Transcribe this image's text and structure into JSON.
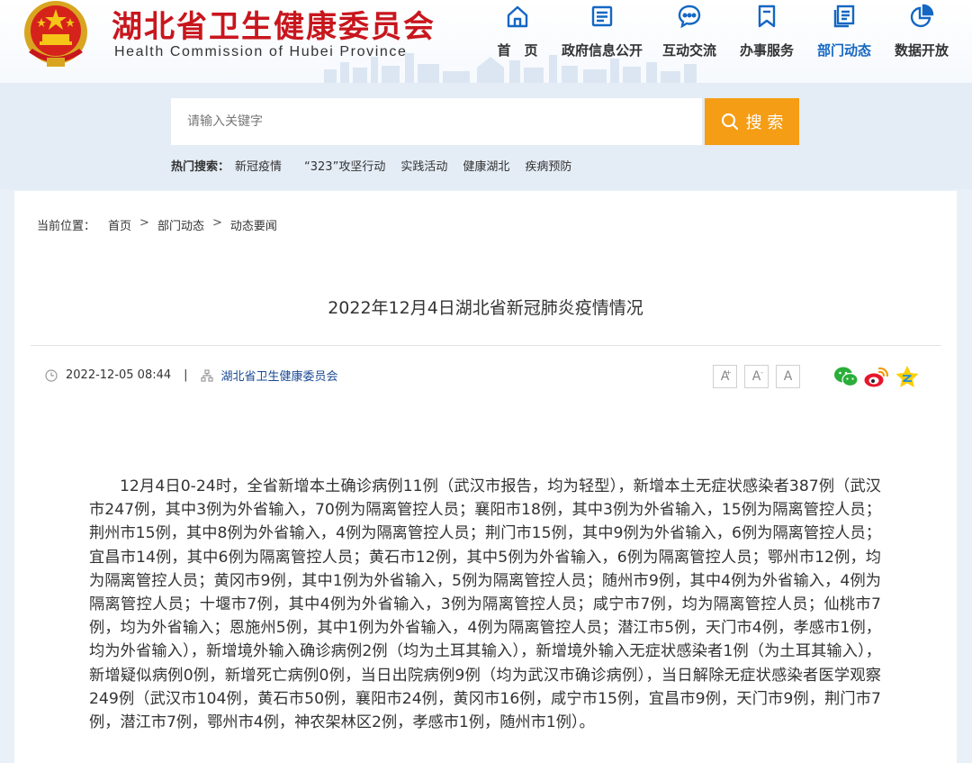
{
  "header": {
    "title": "湖北省卫生健康委员会",
    "subtitle": "Health Commission of Hubei Province"
  },
  "nav": {
    "items": [
      {
        "label": "首　页",
        "icon": "home-icon"
      },
      {
        "label": "政府信息公开",
        "icon": "document-list-icon"
      },
      {
        "label": "互动交流",
        "icon": "chat-bubble-icon"
      },
      {
        "label": "办事服务",
        "icon": "bookmark-icon"
      },
      {
        "label": "部门动态",
        "icon": "pages-icon",
        "active": true
      },
      {
        "label": "数据开放",
        "icon": "pie-chart-icon"
      }
    ]
  },
  "search": {
    "placeholder": "请输入关键字",
    "button_label": "搜 索",
    "hot_label": "热门搜索：",
    "hot_links": [
      "新冠疫情",
      "“323”攻坚行动",
      "实践活动",
      "健康湖北",
      "疾病预防"
    ]
  },
  "breadcrumb": {
    "prefix": "当前位置：",
    "items": [
      "首页",
      "部门动态",
      "动态要闻"
    ],
    "separator": ">"
  },
  "article": {
    "title": "2022年12月4日湖北省新冠肺炎疫情情况",
    "date": "2022-12-05 08:44",
    "divider": "|",
    "source": "湖北省卫生健康委员会",
    "body": "12月4日0-24时，全省新增本土确诊病例11例（武汉市报告，均为轻型），新增本土无症状感染者387例（武汉市247例，其中3例为外省输入，70例为隔离管控人员；襄阳市18例，其中3例为外省输入，15例为隔离管控人员；荆州市15例，其中8例为外省输入，4例为隔离管控人员；荆门市15例，其中9例为外省输入，6例为隔离管控人员；宜昌市14例，其中6例为隔离管控人员；黄石市12例，其中5例为外省输入，6例为隔离管控人员；鄂州市12例，均为隔离管控人员；黄冈市9例，其中1例为外省输入，5例为隔离管控人员；随州市9例，其中4例为外省输入，4例为隔离管控人员；十堰市7例，其中4例为外省输入，3例为隔离管控人员；咸宁市7例，均为隔离管控人员；仙桃市7例，均为外省输入；恩施州5例，其中1例为外省输入，4例为隔离管控人员；潜江市5例，天门市4例，孝感市1例，均为外省输入），新增境外输入确诊病例2例（均为土耳其输入），新增境外输入无症状感染者1例（为土耳其输入），新增疑似病例0例，新增死亡病例0例，当日出院病例9例（均为武汉市确诊病例），当日解除无症状感染者医学观察249例（武汉市104例，黄石市50例，襄阳市24例，黄冈市16例，咸宁市15例，宜昌市9例，天门市9例，荆门市7例，潜江市7例，鄂州市4例，神农架林区2例，孝感市1例，随州市1例）。"
  },
  "tools": {
    "font_sizes": [
      "A",
      "A",
      "A"
    ],
    "font_size_marks": [
      "+",
      "-",
      ""
    ],
    "share_icons": [
      "wechat-icon",
      "weibo-icon",
      "qzone-icon"
    ]
  },
  "colors": {
    "brand_red": "#c8161d",
    "nav_active": "#1467c3",
    "search_button": "#f59d15",
    "band_bg": "#e4ecf5",
    "source_link": "#1a4a94"
  }
}
